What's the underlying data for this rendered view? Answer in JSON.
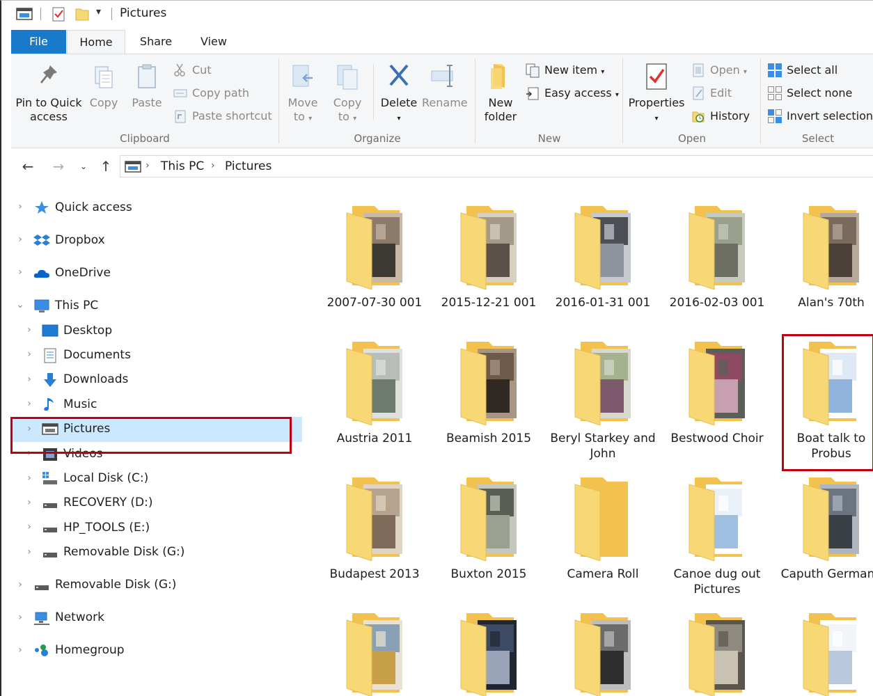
{
  "window": {
    "title": "Pictures"
  },
  "tabs": {
    "file": "File",
    "home": "Home",
    "share": "Share",
    "view": "View"
  },
  "ribbon": {
    "clipboard": {
      "label": "Clipboard",
      "pin": "Pin to Quick access",
      "pin_line1": "Pin to Quick",
      "pin_line2": "access",
      "copy": "Copy",
      "paste": "Paste",
      "cut": "Cut",
      "copy_path": "Copy path",
      "paste_shortcut": "Paste shortcut"
    },
    "organize": {
      "label": "Organize",
      "move_line1": "Move",
      "move_line2": "to",
      "copy_line1": "Copy",
      "copy_line2": "to",
      "delete": "Delete",
      "rename": "Rename"
    },
    "new": {
      "label": "New",
      "folder_line1": "New",
      "folder_line2": "folder",
      "new_item": "New item",
      "easy_access": "Easy access"
    },
    "open": {
      "label": "Open",
      "properties": "Properties",
      "open": "Open",
      "edit": "Edit",
      "history": "History"
    },
    "select": {
      "label": "Select",
      "select_all": "Select all",
      "select_none": "Select none",
      "invert": "Invert selection"
    }
  },
  "address": {
    "crumbs": [
      "This PC",
      "Pictures"
    ]
  },
  "nav": {
    "quick_access": "Quick access",
    "dropbox": "Dropbox",
    "onedrive": "OneDrive",
    "this_pc": "This PC",
    "desktop": "Desktop",
    "documents": "Documents",
    "downloads": "Downloads",
    "music": "Music",
    "pictures": "Pictures",
    "videos": "Videos",
    "local_disk": "Local Disk (C:)",
    "recovery": "RECOVERY (D:)",
    "hp_tools": "HP_TOOLS (E:)",
    "removable_g_child": "Removable Disk (G:)",
    "removable_g": "Removable Disk (G:)",
    "network": "Network",
    "homegroup": "Homegroup"
  },
  "folders": [
    {
      "line1": "2007-07-30 001",
      "line2": ""
    },
    {
      "line1": "2015-12-21 001",
      "line2": ""
    },
    {
      "line1": "2016-01-31 001",
      "line2": ""
    },
    {
      "line1": "2016-02-03 001",
      "line2": ""
    },
    {
      "line1": "Alan's 70th",
      "line2": ""
    },
    {
      "line1": "Austria 2011",
      "line2": ""
    },
    {
      "line1": "Beamish 2015",
      "line2": ""
    },
    {
      "line1": "Beryl Starkey and",
      "line2": "John"
    },
    {
      "line1": "Bestwood Choir",
      "line2": ""
    },
    {
      "line1": "Boat talk to",
      "line2": "Probus"
    },
    {
      "line1": "Budapest 2013",
      "line2": ""
    },
    {
      "line1": "Buxton 2015",
      "line2": ""
    },
    {
      "line1": "Camera Roll",
      "line2": ""
    },
    {
      "line1": "Canoe dug out",
      "line2": "Pictures"
    },
    {
      "line1": "Caputh Germany",
      "line2": ""
    },
    {
      "line1": "",
      "line2": ""
    },
    {
      "line1": "",
      "line2": ""
    },
    {
      "line1": "",
      "line2": ""
    },
    {
      "line1": "",
      "line2": ""
    },
    {
      "line1": "",
      "line2": ""
    }
  ],
  "colors": {
    "accent": "#1979ca",
    "selection": "#cce8ff",
    "highlight": "#c00010",
    "folder": "#f8d775"
  }
}
